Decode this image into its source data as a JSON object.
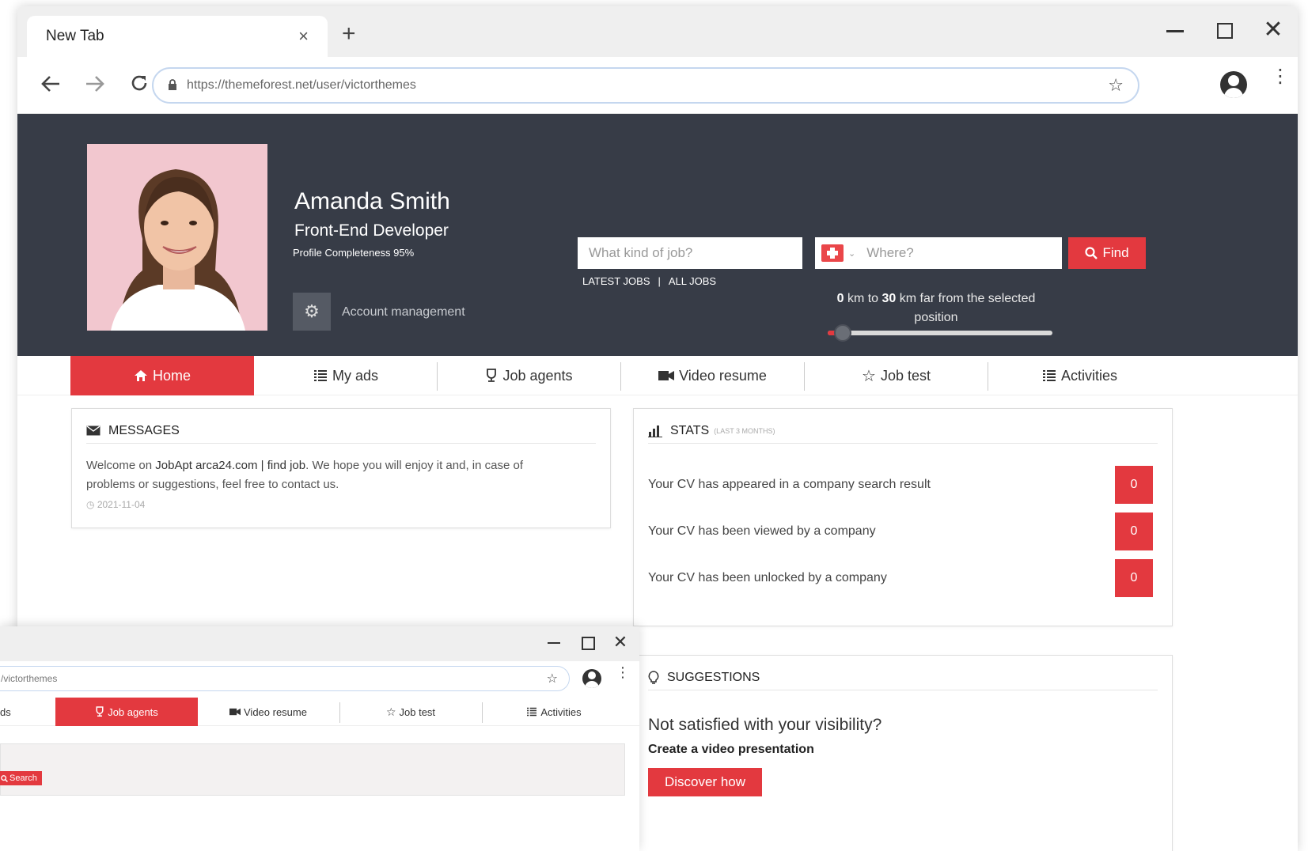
{
  "browser": {
    "tab_title": "New Tab",
    "tab_close": "×",
    "new_tab": "+",
    "url": "https://themeforest.net/user/victorthemes"
  },
  "profile": {
    "name": "Amanda Smith",
    "title": "Front-End Developer",
    "completeness": "Profile Completeness 95%",
    "account_link": "Account management"
  },
  "search": {
    "job_placeholder": "What kind of job?",
    "where_placeholder": "Where?",
    "find_label": "Find",
    "latest_jobs": "LATEST JOBS",
    "separator": "|",
    "all_jobs": "ALL JOBS",
    "range_min": "0",
    "range_max": "30",
    "range_text_1": "km to",
    "range_text_2": "km far from the selected position",
    "slider_value_fraction": 0.05
  },
  "nav": {
    "items": [
      {
        "label": "Home",
        "icon": "home-icon",
        "active": true
      },
      {
        "label": "My ads",
        "icon": "list-icon",
        "active": false
      },
      {
        "label": "Job agents",
        "icon": "trophy-icon",
        "active": false
      },
      {
        "label": "Video resume",
        "icon": "video-icon",
        "active": false
      },
      {
        "label": "Job test",
        "icon": "star-icon",
        "active": false
      },
      {
        "label": "Activities",
        "icon": "list-icon",
        "active": false
      }
    ]
  },
  "messages": {
    "title": "MESSAGES",
    "body_prefix": "Welcome on ",
    "body_brand": "JobApt arca24.com | find job",
    "body_suffix": ". We hope you will enjoy it and, in case of problems or suggestions, feel free to contact us.",
    "date": "2021-11-04"
  },
  "stats": {
    "title": "STATS",
    "subtitle": "(LAST 3 MONTHS)",
    "rows": [
      {
        "label": "Your CV has appeared in a company search result",
        "count": "0"
      },
      {
        "label": "Your CV has been viewed by a company",
        "count": "0"
      },
      {
        "label": "Your CV has been unlocked by a company",
        "count": "0"
      }
    ]
  },
  "suggestions": {
    "title": "SUGGESTIONS",
    "heading": "Not satisfied with your visibility?",
    "subheading": "Create a video presentation",
    "button": "Discover how"
  },
  "second_window": {
    "url_fragment": "/victorthemes",
    "nav": [
      {
        "label": "ds"
      },
      {
        "label": "Job agents",
        "active": true
      },
      {
        "label": "Video resume"
      },
      {
        "label": "Job test"
      },
      {
        "label": "Activities"
      }
    ],
    "search_label": "Search"
  },
  "colors": {
    "accent": "#e3393f",
    "hero_bg": "#373c47"
  }
}
